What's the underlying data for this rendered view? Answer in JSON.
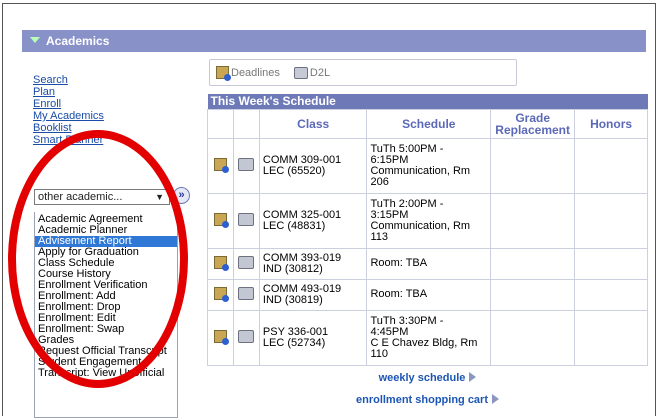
{
  "section": {
    "title": "Academics"
  },
  "nav": [
    {
      "label": "Search"
    },
    {
      "label": "Plan"
    },
    {
      "label": "Enroll"
    },
    {
      "label": "My Academics"
    },
    {
      "label": "Booklist"
    },
    {
      "label": "Smart Planner"
    }
  ],
  "dropdown": {
    "selected": "other academic...",
    "go_glyph": "»",
    "options": [
      "Academic Agreement",
      "Academic Planner",
      "Advisement Report",
      "Apply for Graduation",
      "Class Schedule",
      "Course History",
      "Enrollment Verification",
      "Enrollment: Add",
      "Enrollment: Drop",
      "Enrollment: Edit",
      "Enrollment: Swap",
      "Grades",
      "Request Official Transcript",
      "Student Engagement",
      "Transcript: View Unofficial"
    ],
    "highlighted": "Advisement Report"
  },
  "tools": {
    "deadlines": "Deadlines",
    "d2l": "D2L"
  },
  "schedule": {
    "caption": "This Week's Schedule",
    "headers": {
      "class": "Class",
      "schedule": "Schedule",
      "grade_replacement": "Grade Replacement",
      "honors": "Honors"
    },
    "rows": [
      {
        "class_line1": "COMM 309-001",
        "class_line2": "LEC (65520)",
        "sched_lines": [
          "TuTh 5:00PM -",
          "6:15PM",
          "Communication, Rm",
          "206"
        ]
      },
      {
        "class_line1": "COMM 325-001",
        "class_line2": "LEC (48831)",
        "sched_lines": [
          "TuTh 2:00PM -",
          "3:15PM",
          "Communication, Rm",
          "113"
        ]
      },
      {
        "class_line1": "COMM 393-019",
        "class_line2": "IND (30812)",
        "sched_lines": [
          "Room:  TBA"
        ]
      },
      {
        "class_line1": "COMM 493-019",
        "class_line2": "IND (30819)",
        "sched_lines": [
          "Room:  TBA"
        ]
      },
      {
        "class_line1": "PSY 336-001",
        "class_line2": "LEC (52734)",
        "sched_lines": [
          "TuTh 3:30PM -",
          "4:45PM",
          "C E Chavez Bldg, Rm",
          "110"
        ]
      }
    ]
  },
  "links": {
    "weekly": "weekly schedule",
    "cart": "enrollment shopping cart"
  }
}
